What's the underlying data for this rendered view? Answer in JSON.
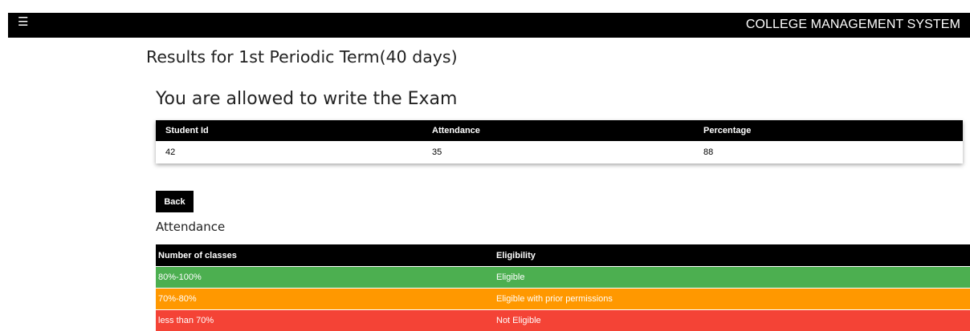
{
  "header": {
    "menu_icon": "menu-icon",
    "title": "COLLEGE MANAGEMENT SYSTEM"
  },
  "page": {
    "title": "Results for 1st Periodic Term(40 days)",
    "result_message": "You are allowed to write the Exam"
  },
  "result_table": {
    "headers": [
      "Student Id",
      "Attendance",
      "Percentage"
    ],
    "rows": [
      [
        "42",
        "35",
        "88"
      ]
    ]
  },
  "back_button": {
    "label": "Back"
  },
  "attendance": {
    "heading": "Attendance",
    "headers": [
      "Number of classes",
      "Eligibility"
    ],
    "rows": [
      {
        "range": "80%-100%",
        "eligibility": "Eligible",
        "color": "#4caf50"
      },
      {
        "range": "70%-80%",
        "eligibility": "Eligible with prior permissions",
        "color": "#ff9800"
      },
      {
        "range": "less than 70%",
        "eligibility": "Not Eligible",
        "color": "#f44336"
      }
    ]
  }
}
